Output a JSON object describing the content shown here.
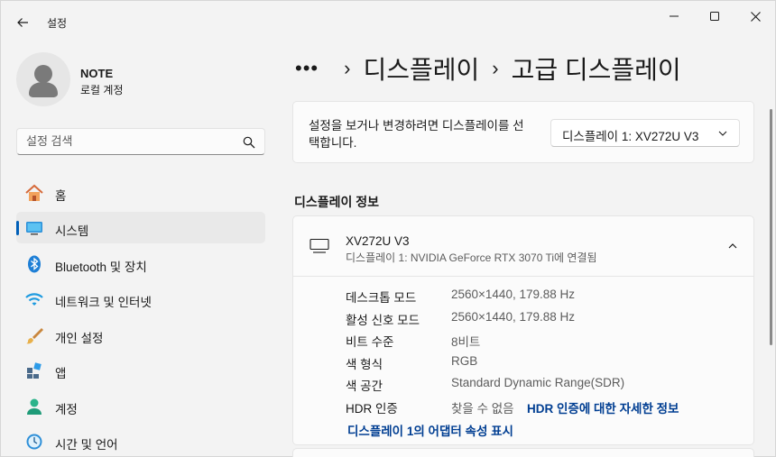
{
  "app": {
    "title": "설정"
  },
  "window_controls": {
    "minimize": "minimize-icon",
    "maximize": "maximize-icon",
    "close": "close-icon"
  },
  "profile": {
    "name": "NOTE",
    "account_type": "로컬 계정"
  },
  "search": {
    "placeholder": "설정 검색"
  },
  "sidebar": {
    "items": [
      {
        "label": "홈",
        "icon": "home-icon"
      },
      {
        "label": "시스템",
        "icon": "system-icon",
        "active": true
      },
      {
        "label": "Bluetooth 및 장치",
        "icon": "bluetooth-icon"
      },
      {
        "label": "네트워크 및 인터넷",
        "icon": "wifi-icon"
      },
      {
        "label": "개인 설정",
        "icon": "brush-icon"
      },
      {
        "label": "앱",
        "icon": "apps-icon"
      },
      {
        "label": "계정",
        "icon": "account-icon"
      },
      {
        "label": "시간 및 언어",
        "icon": "globe-clock-icon"
      }
    ]
  },
  "breadcrumb": {
    "dots": "•••",
    "sep": "›",
    "parent": "디스플레이",
    "current": "고급 디스플레이"
  },
  "display_select": {
    "description": "설정을 보거나 변경하려면 디스플레이를 선택합니다.",
    "selected": "디스플레이 1: XV272U V3"
  },
  "display_info": {
    "section_title": "디스플레이 정보",
    "monitor_name": "XV272U V3",
    "monitor_sub": "디스플레이 1: NVIDIA GeForce RTX 3070 Ti에 연결됨",
    "rows": [
      {
        "label": "데스크톱 모드",
        "value": "2560×1440, 179.88 Hz"
      },
      {
        "label": "활성 신호 모드",
        "value": "2560×1440, 179.88 Hz"
      },
      {
        "label": "비트 수준",
        "value": "8비트"
      },
      {
        "label": "색 형식",
        "value": "RGB"
      },
      {
        "label": "색 공간",
        "value": "Standard Dynamic Range(SDR)"
      },
      {
        "label": "HDR 인증",
        "value": "찾을 수 없음",
        "link": "HDR 인증에 대한 자세한 정보"
      }
    ],
    "adapter_link": "디스플레이 1의 어댑터 속성 표시"
  },
  "colors": {
    "accent": "#005fb8",
    "link": "#003e92",
    "background": "#f3f3f3",
    "card": "#fbfbfb"
  }
}
